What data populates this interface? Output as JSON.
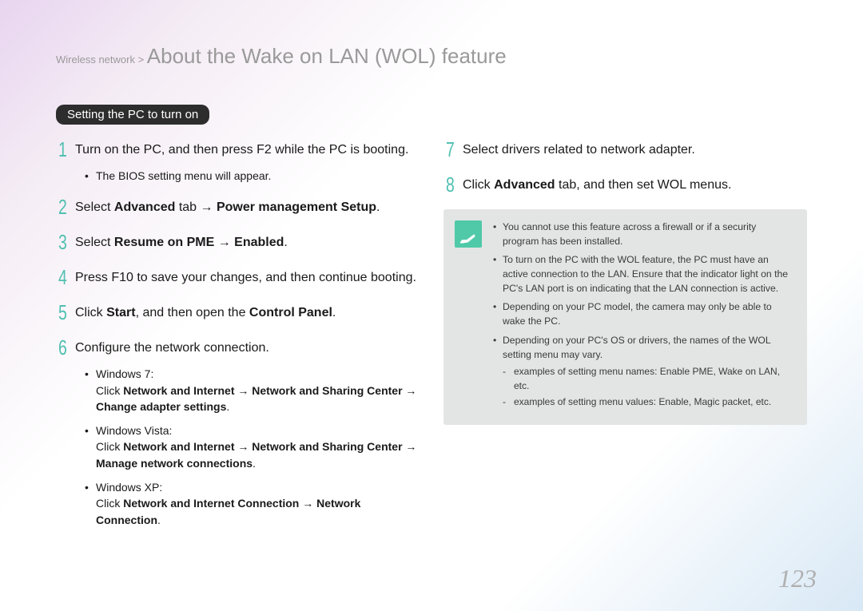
{
  "breadcrumb": "Wireless network > ",
  "title": "About the Wake on LAN (WOL) feature",
  "pill": "Setting the PC to turn on",
  "left_steps": [
    {
      "num": "1",
      "html": "Turn on the PC, and then press F2 while the PC is booting.",
      "sub": [
        {
          "html": "The BIOS setting menu will appear."
        }
      ]
    },
    {
      "num": "2",
      "html": "Select <b>Advanced</b> tab → <b>Power management Setup</b>."
    },
    {
      "num": "3",
      "html": "Select <b>Resume on PME</b> → <b>Enabled</b>."
    },
    {
      "num": "4",
      "html": "Press F10 to save your changes, and then continue booting."
    },
    {
      "num": "5",
      "html": "Click <b>Start</b>, and then open the <b>Control Panel</b>."
    },
    {
      "num": "6",
      "html": "Configure the network connection.",
      "sub": [
        {
          "html": "Windows 7:<br>Click <b>Network and Internet</b> → <b>Network and Sharing Center</b> → <b>Change adapter settings</b>."
        },
        {
          "html": "Windows Vista:<br>Click <b>Network and Internet</b> → <b>Network and Sharing Center</b> → <b>Manage network connections</b>."
        },
        {
          "html": "Windows XP:<br>Click <b>Network and Internet Connection</b> → <b>Network Connection</b>."
        }
      ]
    }
  ],
  "right_steps": [
    {
      "num": "7",
      "html": "Select drivers related to network adapter."
    },
    {
      "num": "8",
      "html": "Click <b>Advanced</b> tab, and then set WOL menus."
    }
  ],
  "notes": [
    {
      "html": "You cannot use this feature across a firewall or if a security program has been installed."
    },
    {
      "html": "To turn on the PC with the WOL feature, the PC must have an active connection to the LAN. Ensure that the indicator light on the PC's LAN port is on indicating that the LAN connection is active."
    },
    {
      "html": "Depending on your PC model, the camera may only be able to wake the PC."
    },
    {
      "html": "Depending on your PC's OS or drivers, the names of the WOL setting menu may vary.",
      "sub": [
        {
          "html": "examples of setting menu names: Enable PME, Wake on LAN, etc."
        },
        {
          "html": "examples of setting menu values: Enable, Magic packet, etc."
        }
      ]
    }
  ],
  "page_number": "123"
}
